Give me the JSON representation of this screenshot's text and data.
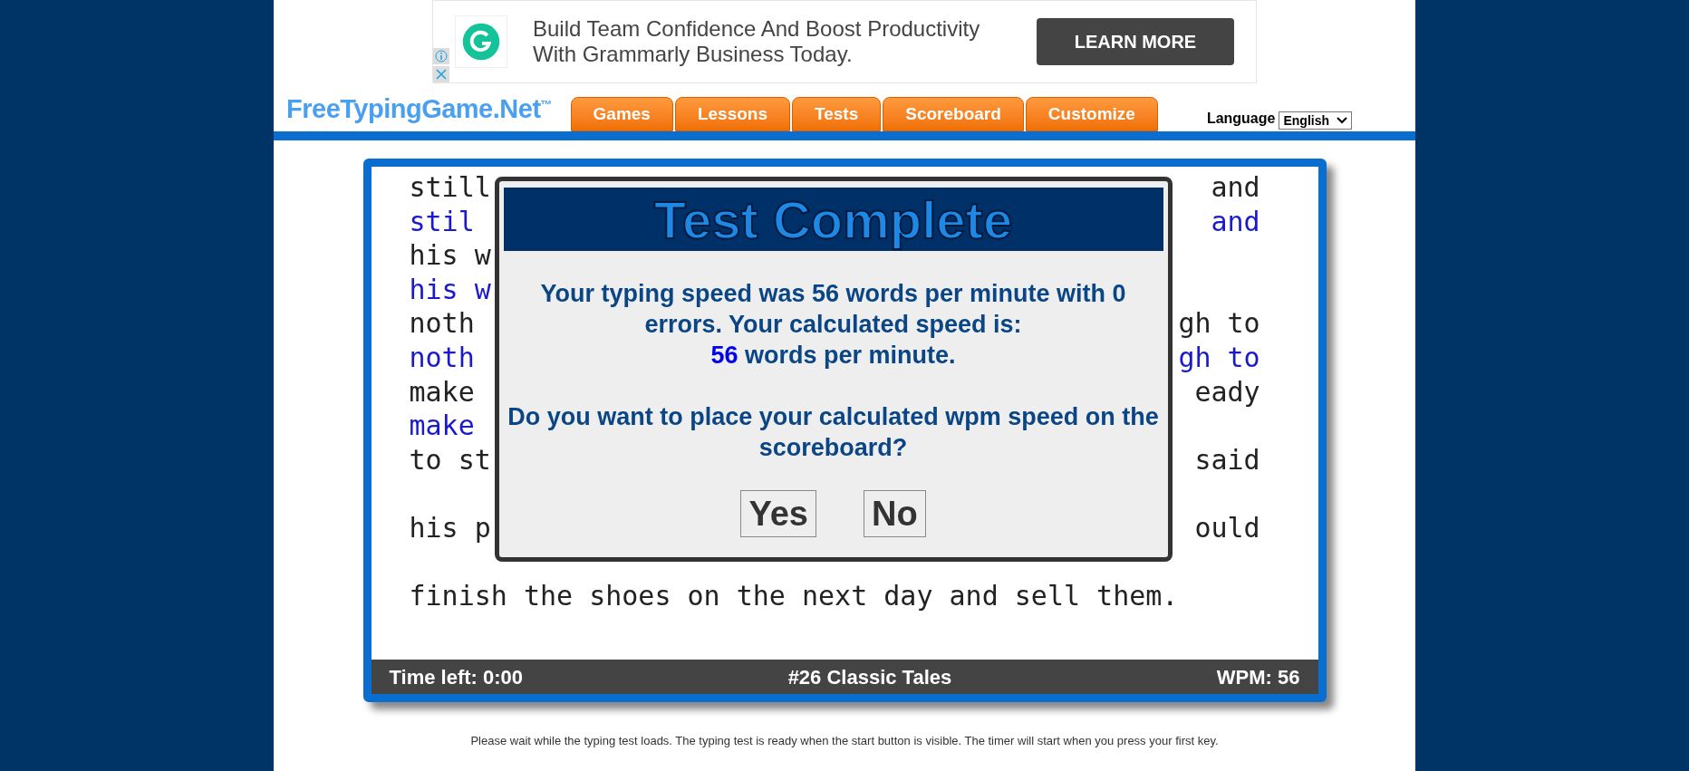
{
  "ad": {
    "headline": "Build Team Confidence And Boost Productivity With Grammarly Business Today.",
    "button": "LEARN MORE"
  },
  "header": {
    "logo": "FreeTypingGame.Net",
    "trademark": "™",
    "language_label": "Language",
    "language_value": "English"
  },
  "tabs": [
    {
      "label": "Games"
    },
    {
      "label": "Lessons"
    },
    {
      "label": "Tests"
    },
    {
      "label": "Scoreboard"
    },
    {
      "label": "Customize"
    }
  ],
  "typing_lines": [
    {
      "kind": "prompt",
      "left": "still",
      "right": "and"
    },
    {
      "kind": "typed",
      "left": "stil",
      "right": "and"
    },
    {
      "kind": "prompt",
      "left": "his w"
    },
    {
      "kind": "typed",
      "left": "his w"
    },
    {
      "kind": "prompt",
      "left": "noth",
      "right": "gh to"
    },
    {
      "kind": "typed",
      "left": "noth",
      "right": "gh to"
    },
    {
      "kind": "prompt",
      "left": "make",
      "right": "eady"
    },
    {
      "kind": "typed",
      "left": "make"
    },
    {
      "kind": "prompt",
      "left": "to st",
      "right": "said"
    },
    {
      "kind": "blank"
    },
    {
      "kind": "prompt",
      "left": "his p",
      "right": "ould"
    },
    {
      "kind": "blank"
    },
    {
      "kind": "prompt",
      "left": "finish the shoes on the next day and sell them."
    }
  ],
  "status_bar": {
    "time_left": "Time left: 0:00",
    "test_name": "#26 Classic Tales",
    "wpm": "WPM: 56"
  },
  "dialog": {
    "title": "Test Complete",
    "result": "Your typing speed was **56** words per minute with **0** errors. Your calculated speed is:",
    "speed_value": "56",
    "speed_unit": " words per minute.",
    "question": "Do you want to place your calculated wpm speed on the scoreboard?",
    "buttons": [
      "Yes",
      "No"
    ]
  },
  "footer_note": "Please wait while the typing test loads. The typing test is ready when the start button is visible. The timer will start when you press your first key."
}
